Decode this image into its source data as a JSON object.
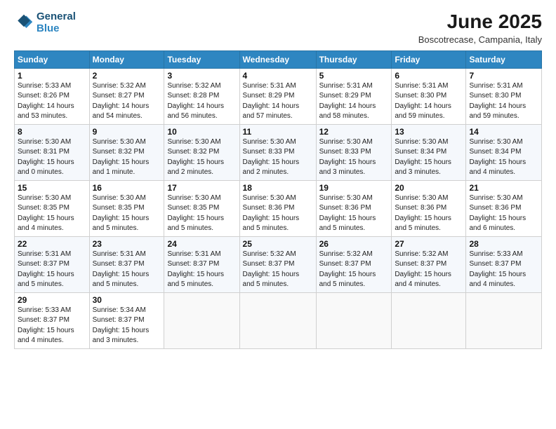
{
  "logo": {
    "line1": "General",
    "line2": "Blue"
  },
  "title": "June 2025",
  "location": "Boscotrecase, Campania, Italy",
  "days_of_week": [
    "Sunday",
    "Monday",
    "Tuesday",
    "Wednesday",
    "Thursday",
    "Friday",
    "Saturday"
  ],
  "weeks": [
    [
      {
        "day": 1,
        "info": "Sunrise: 5:33 AM\nSunset: 8:26 PM\nDaylight: 14 hours\nand 53 minutes."
      },
      {
        "day": 2,
        "info": "Sunrise: 5:32 AM\nSunset: 8:27 PM\nDaylight: 14 hours\nand 54 minutes."
      },
      {
        "day": 3,
        "info": "Sunrise: 5:32 AM\nSunset: 8:28 PM\nDaylight: 14 hours\nand 56 minutes."
      },
      {
        "day": 4,
        "info": "Sunrise: 5:31 AM\nSunset: 8:29 PM\nDaylight: 14 hours\nand 57 minutes."
      },
      {
        "day": 5,
        "info": "Sunrise: 5:31 AM\nSunset: 8:29 PM\nDaylight: 14 hours\nand 58 minutes."
      },
      {
        "day": 6,
        "info": "Sunrise: 5:31 AM\nSunset: 8:30 PM\nDaylight: 14 hours\nand 59 minutes."
      },
      {
        "day": 7,
        "info": "Sunrise: 5:31 AM\nSunset: 8:30 PM\nDaylight: 14 hours\nand 59 minutes."
      }
    ],
    [
      {
        "day": 8,
        "info": "Sunrise: 5:30 AM\nSunset: 8:31 PM\nDaylight: 15 hours\nand 0 minutes."
      },
      {
        "day": 9,
        "info": "Sunrise: 5:30 AM\nSunset: 8:32 PM\nDaylight: 15 hours\nand 1 minute."
      },
      {
        "day": 10,
        "info": "Sunrise: 5:30 AM\nSunset: 8:32 PM\nDaylight: 15 hours\nand 2 minutes."
      },
      {
        "day": 11,
        "info": "Sunrise: 5:30 AM\nSunset: 8:33 PM\nDaylight: 15 hours\nand 2 minutes."
      },
      {
        "day": 12,
        "info": "Sunrise: 5:30 AM\nSunset: 8:33 PM\nDaylight: 15 hours\nand 3 minutes."
      },
      {
        "day": 13,
        "info": "Sunrise: 5:30 AM\nSunset: 8:34 PM\nDaylight: 15 hours\nand 3 minutes."
      },
      {
        "day": 14,
        "info": "Sunrise: 5:30 AM\nSunset: 8:34 PM\nDaylight: 15 hours\nand 4 minutes."
      }
    ],
    [
      {
        "day": 15,
        "info": "Sunrise: 5:30 AM\nSunset: 8:35 PM\nDaylight: 15 hours\nand 4 minutes."
      },
      {
        "day": 16,
        "info": "Sunrise: 5:30 AM\nSunset: 8:35 PM\nDaylight: 15 hours\nand 5 minutes."
      },
      {
        "day": 17,
        "info": "Sunrise: 5:30 AM\nSunset: 8:35 PM\nDaylight: 15 hours\nand 5 minutes."
      },
      {
        "day": 18,
        "info": "Sunrise: 5:30 AM\nSunset: 8:36 PM\nDaylight: 15 hours\nand 5 minutes."
      },
      {
        "day": 19,
        "info": "Sunrise: 5:30 AM\nSunset: 8:36 PM\nDaylight: 15 hours\nand 5 minutes."
      },
      {
        "day": 20,
        "info": "Sunrise: 5:30 AM\nSunset: 8:36 PM\nDaylight: 15 hours\nand 5 minutes."
      },
      {
        "day": 21,
        "info": "Sunrise: 5:30 AM\nSunset: 8:36 PM\nDaylight: 15 hours\nand 6 minutes."
      }
    ],
    [
      {
        "day": 22,
        "info": "Sunrise: 5:31 AM\nSunset: 8:37 PM\nDaylight: 15 hours\nand 5 minutes."
      },
      {
        "day": 23,
        "info": "Sunrise: 5:31 AM\nSunset: 8:37 PM\nDaylight: 15 hours\nand 5 minutes."
      },
      {
        "day": 24,
        "info": "Sunrise: 5:31 AM\nSunset: 8:37 PM\nDaylight: 15 hours\nand 5 minutes."
      },
      {
        "day": 25,
        "info": "Sunrise: 5:32 AM\nSunset: 8:37 PM\nDaylight: 15 hours\nand 5 minutes."
      },
      {
        "day": 26,
        "info": "Sunrise: 5:32 AM\nSunset: 8:37 PM\nDaylight: 15 hours\nand 5 minutes."
      },
      {
        "day": 27,
        "info": "Sunrise: 5:32 AM\nSunset: 8:37 PM\nDaylight: 15 hours\nand 4 minutes."
      },
      {
        "day": 28,
        "info": "Sunrise: 5:33 AM\nSunset: 8:37 PM\nDaylight: 15 hours\nand 4 minutes."
      }
    ],
    [
      {
        "day": 29,
        "info": "Sunrise: 5:33 AM\nSunset: 8:37 PM\nDaylight: 15 hours\nand 4 minutes."
      },
      {
        "day": 30,
        "info": "Sunrise: 5:34 AM\nSunset: 8:37 PM\nDaylight: 15 hours\nand 3 minutes."
      },
      null,
      null,
      null,
      null,
      null
    ]
  ]
}
